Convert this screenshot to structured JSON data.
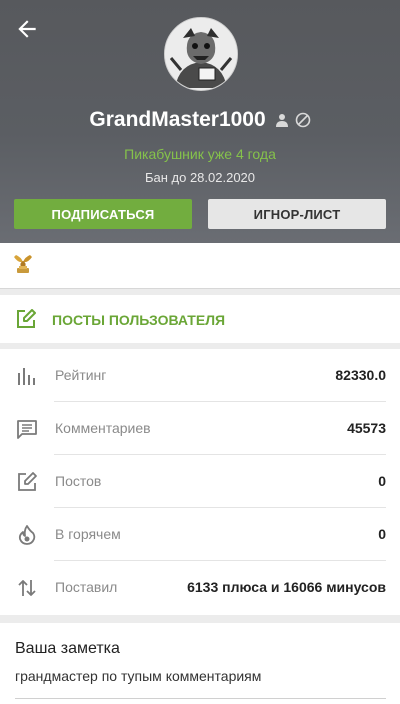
{
  "header": {
    "username": "GrandMaster1000",
    "subtitle": "Пикабушник уже 4 года",
    "ban_text": "Бан до 28.02.2020",
    "subscribe_label": "ПОДПИСАТЬСЯ",
    "ignore_label": "ИГНОР-ЛИСТ",
    "icons": [
      "back-arrow-icon",
      "person-icon",
      "banned-icon"
    ]
  },
  "posts_link": {
    "label": "ПОСТЫ ПОЛЬЗОВАТЕЛЯ",
    "icon": "edit-icon"
  },
  "stats": [
    {
      "icon": "bar-chart-icon",
      "label": "Рейтинг",
      "value": "82330.0"
    },
    {
      "icon": "comment-icon",
      "label": "Комментариев",
      "value": "45573"
    },
    {
      "icon": "edit-icon",
      "label": "Постов",
      "value": "0"
    },
    {
      "icon": "fire-icon",
      "label": "В горячем",
      "value": "0"
    },
    {
      "icon": "swap-arrows-icon",
      "label": "Поставил",
      "value": "6133 плюса и 16066 минусов"
    }
  ],
  "note": {
    "title": "Ваша заметка",
    "text": "грандмастер по тупым комментариям"
  },
  "colors": {
    "accent": "#72ad3f",
    "header_bg": "#5a5c61",
    "subtitle_green": "#85c24b"
  }
}
